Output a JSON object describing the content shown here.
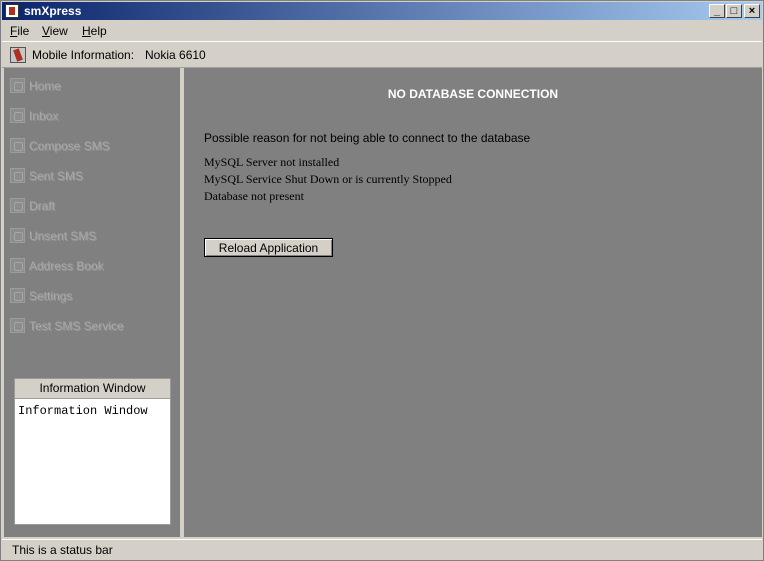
{
  "window": {
    "title": "smXpress",
    "controls": {
      "minimize": "_",
      "maximize": "□",
      "close": "×"
    }
  },
  "menu": [
    {
      "label": "File"
    },
    {
      "label": "View"
    },
    {
      "label": "Help"
    }
  ],
  "infobar": {
    "label": "Mobile Information:",
    "value": "Nokia 6610",
    "icon": "phone-icon"
  },
  "sidebar": {
    "items": [
      {
        "label": "Home",
        "icon": "home-icon",
        "enabled": false
      },
      {
        "label": "Inbox",
        "icon": "inbox-icon",
        "enabled": false
      },
      {
        "label": "Compose SMS",
        "icon": "compose-icon",
        "enabled": false
      },
      {
        "label": "Sent SMS",
        "icon": "sent-icon",
        "enabled": false
      },
      {
        "label": "Draft",
        "icon": "draft-icon",
        "enabled": false
      },
      {
        "label": "Unsent SMS",
        "icon": "unsent-icon",
        "enabled": false
      },
      {
        "label": "Address Book",
        "icon": "address-book-icon",
        "enabled": false
      },
      {
        "label": "Settings",
        "icon": "settings-icon",
        "enabled": false
      },
      {
        "label": "Test SMS Service",
        "icon": "test-icon",
        "enabled": false
      }
    ],
    "info_window": {
      "header": "Information Window",
      "content": "Information Window"
    }
  },
  "main": {
    "title": "NO DATABASE CONNECTION",
    "reason_heading": "Possible reason for not being able to connect to the database",
    "reasons": [
      "MySQL Server not installed",
      "MySQL Service Shut Down or is currently Stopped",
      "Database not present"
    ],
    "reload_button": "Reload Application"
  },
  "statusbar": {
    "text": "This is a status bar"
  },
  "colors": {
    "panel_bg": "#808080",
    "chrome_bg": "#d4d0c8",
    "title_gradient_start": "#0a246a",
    "title_gradient_end": "#a6caf0"
  }
}
